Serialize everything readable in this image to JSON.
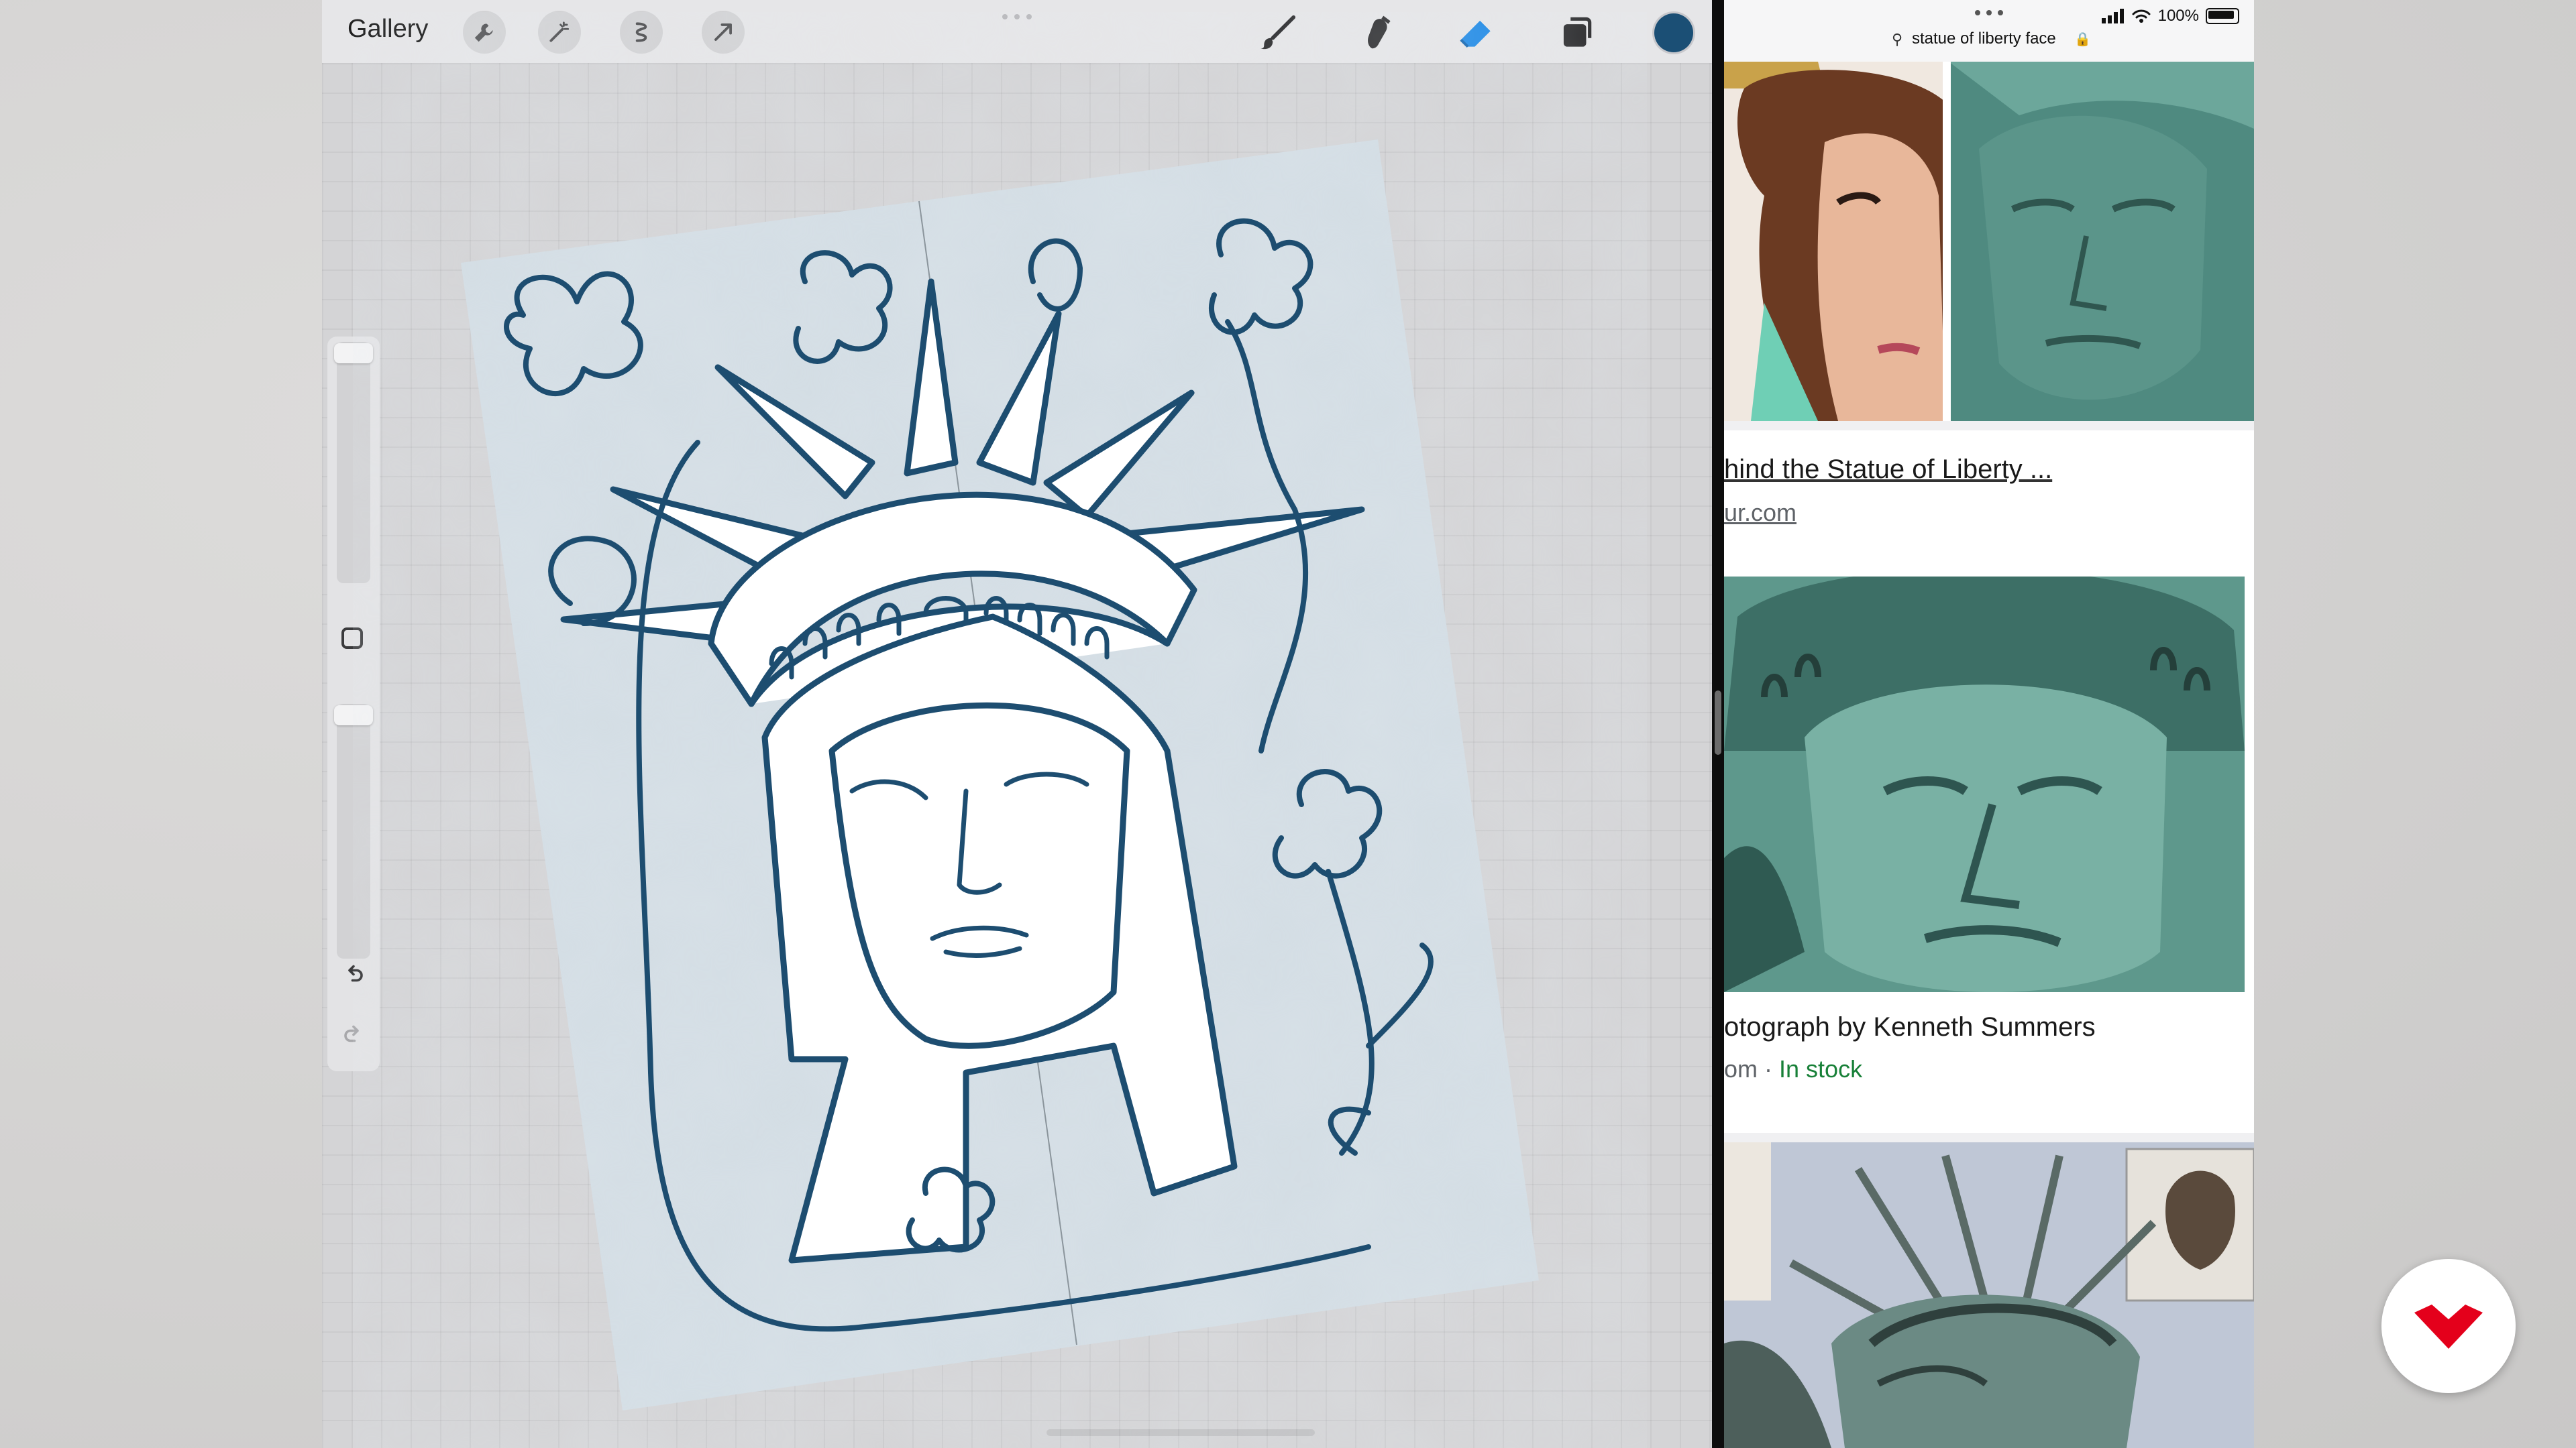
{
  "procreate": {
    "gallery_label": "Gallery",
    "tools_left": [
      "wrench-icon",
      "magic-wand-icon",
      "selection-icon",
      "transform-arrow-icon"
    ],
    "tools_right": [
      "brush-icon",
      "smudge-icon",
      "eraser-icon",
      "layers-icon"
    ],
    "active_tool": "eraser-icon",
    "active_color": "#1b4f75",
    "canvas": {
      "paper_color": "#d3dde4",
      "ink_color": "#1d4d70",
      "rotation_deg": -6
    }
  },
  "safari": {
    "search_query": "statue of liberty face",
    "battery": "100%",
    "results": [
      {
        "title": "hind the Statue of Liberty ...",
        "source": "ur.com",
        "stock": ""
      },
      {
        "title": "otograph by Kenneth Summers",
        "source": "om",
        "stock": "In stock"
      }
    ]
  },
  "colors": {
    "verdigris": "#5f9e92",
    "verdigris_dark": "#3c6e66",
    "logo_red": "#e4001b"
  }
}
